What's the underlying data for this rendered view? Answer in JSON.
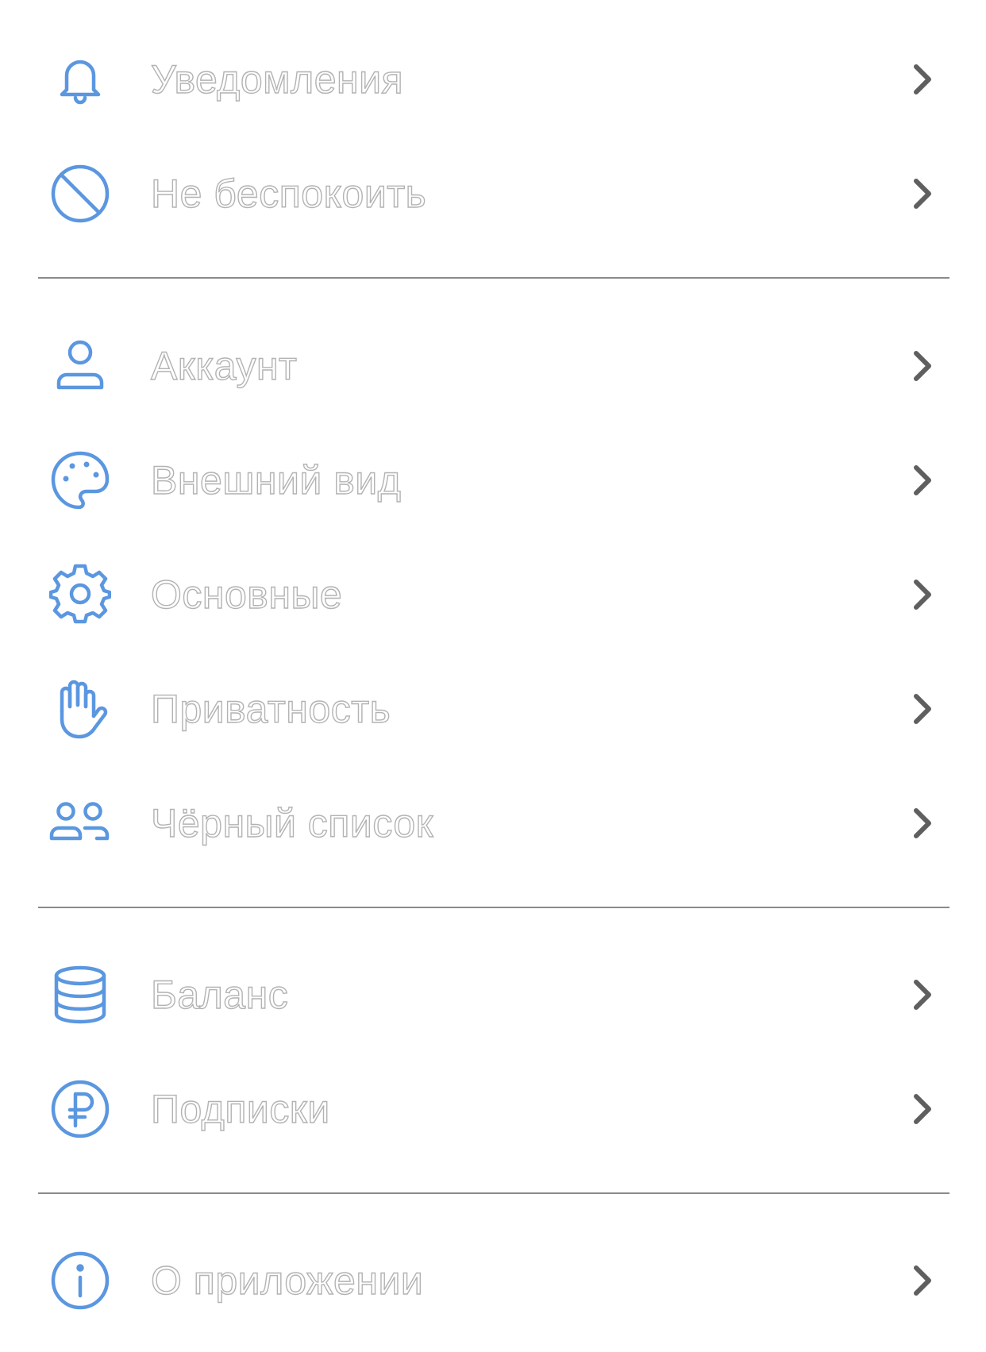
{
  "colors": {
    "icon_accent": "#5b97e0",
    "label_outline": "#b3b3b3",
    "chevron": "#5f5f5f",
    "divider": "#8a8a8a"
  },
  "groups": [
    {
      "items": [
        {
          "label": "Уведомления",
          "icon": "bell-icon"
        },
        {
          "label": "Не беспокоить",
          "icon": "do-not-disturb-icon"
        }
      ]
    },
    {
      "items": [
        {
          "label": "Аккаунт",
          "icon": "person-icon"
        },
        {
          "label": "Внешний вид",
          "icon": "palette-icon"
        },
        {
          "label": "Основные",
          "icon": "gear-icon"
        },
        {
          "label": "Приватность",
          "icon": "hand-icon"
        },
        {
          "label": "Чёрный список",
          "icon": "people-icon"
        }
      ]
    },
    {
      "items": [
        {
          "label": "Баланс",
          "icon": "coins-icon"
        },
        {
          "label": "Подписки",
          "icon": "ruble-icon"
        }
      ]
    },
    {
      "items": [
        {
          "label": "О приложении",
          "icon": "info-icon"
        }
      ]
    }
  ]
}
